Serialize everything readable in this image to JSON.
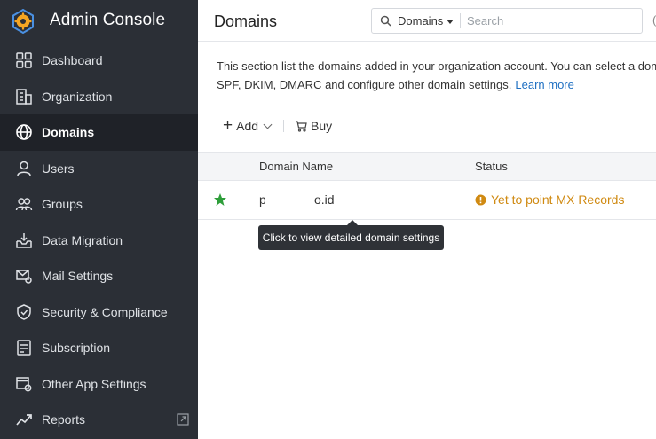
{
  "app": {
    "title": "Admin Console"
  },
  "sidebar": {
    "items": [
      {
        "label": "Dashboard",
        "icon": "dashboard-icon"
      },
      {
        "label": "Organization",
        "icon": "organization-icon"
      },
      {
        "label": "Domains",
        "icon": "globe-icon",
        "active": true
      },
      {
        "label": "Users",
        "icon": "user-icon"
      },
      {
        "label": "Groups",
        "icon": "groups-icon"
      },
      {
        "label": "Data Migration",
        "icon": "data-migration-icon"
      },
      {
        "label": "Mail Settings",
        "icon": "mail-settings-icon"
      },
      {
        "label": "Security & Compliance",
        "icon": "shield-icon"
      },
      {
        "label": "Subscription",
        "icon": "subscription-icon"
      },
      {
        "label": "Other App Settings",
        "icon": "app-settings-icon"
      },
      {
        "label": "Reports",
        "icon": "reports-icon",
        "external_icon": "external-link-icon"
      }
    ]
  },
  "header": {
    "title": "Domains",
    "search": {
      "scope": "Domains",
      "placeholder": "Search"
    },
    "cut_text": "("
  },
  "description": {
    "line1": "This section list the domains added in your organization account. You can select a domain",
    "line2": "SPF, DKIM, DMARC and configure other domain settings.",
    "learn_more": "Learn more"
  },
  "toolbar": {
    "add_label": "Add",
    "buy_label": "Buy"
  },
  "table": {
    "headers": {
      "domain": "Domain Name",
      "status": "Status"
    },
    "rows": [
      {
        "domain_prefix": "p",
        "domain_suffix": "o.id",
        "status": "Yet to point MX Records",
        "starred": true
      }
    ]
  },
  "tooltip": {
    "text": "Click to view detailed domain settings"
  },
  "colors": {
    "sidebar_bg": "#2b2f36",
    "accent_link": "#1e6fc2",
    "warning": "#d08a12",
    "star": "#2e9e3a"
  }
}
